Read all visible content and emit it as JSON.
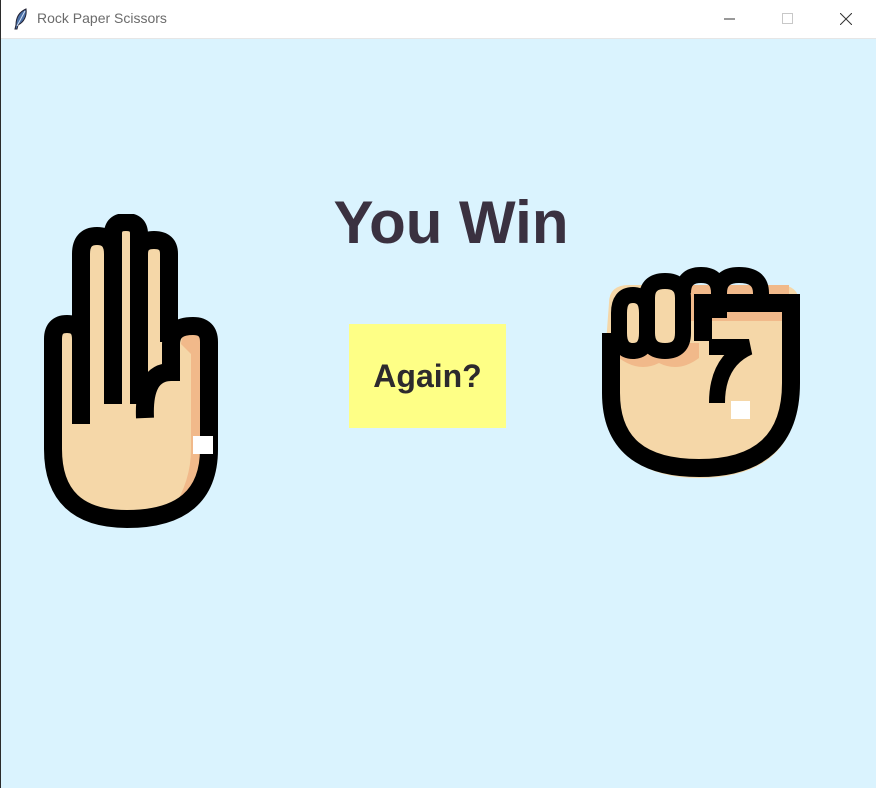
{
  "window": {
    "title": "Rock Paper Scissors",
    "app_icon": "feather-icon",
    "controls": [
      "minimize-icon",
      "maximize-icon",
      "close-icon"
    ]
  },
  "game": {
    "result_text": "You Win",
    "again_label": "Again?",
    "player_choice": "paper",
    "computer_choice": "rock",
    "player_icon": "open-hand-icon",
    "computer_icon": "fist-icon"
  },
  "colors": {
    "background": "#daf3fe",
    "button": "#feff86",
    "result_text": "#3a3140",
    "skin": "#f5d7a8",
    "skin_shadow": "#f1b98a",
    "outline": "#000000"
  }
}
